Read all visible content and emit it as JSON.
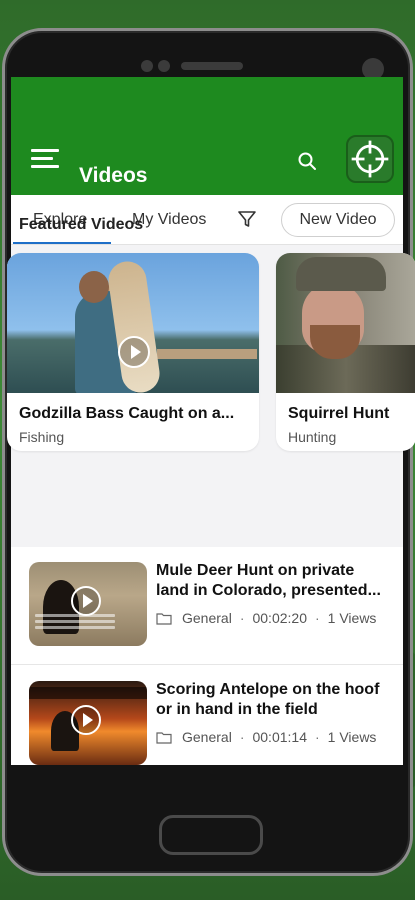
{
  "app": {
    "title": "Videos"
  },
  "icons": {
    "menu": "hamburger-menu-icon",
    "search": "search-icon",
    "logo": "crosshair-logo-icon",
    "filter": "filter-icon",
    "play": "play-icon",
    "folder": "folder-icon"
  },
  "tabs": {
    "explore": "Explore",
    "my_videos": "My Videos",
    "new_video": "New Video"
  },
  "featured": {
    "heading": "Featured Videos",
    "cards": [
      {
        "title": "Godzilla Bass Caught on a...",
        "category": "Fishing"
      },
      {
        "title": "Squirrel Hunt",
        "category": "Hunting"
      }
    ]
  },
  "videos": [
    {
      "title_line1": "Mule Deer Hunt on private",
      "title_line2": "land in Colorado, presented...",
      "folder": "General",
      "duration": "00:02:20",
      "views": "1 Views"
    },
    {
      "title_line1": "Scoring Antelope on the hoof",
      "title_line2": "or in hand in the field",
      "folder": "General",
      "duration": "00:01:14",
      "views": "1 Views"
    }
  ],
  "colors": {
    "appbar": "#1e8a1f",
    "tab_indicator": "#1e6fc8",
    "background": "#f3f3f5"
  }
}
